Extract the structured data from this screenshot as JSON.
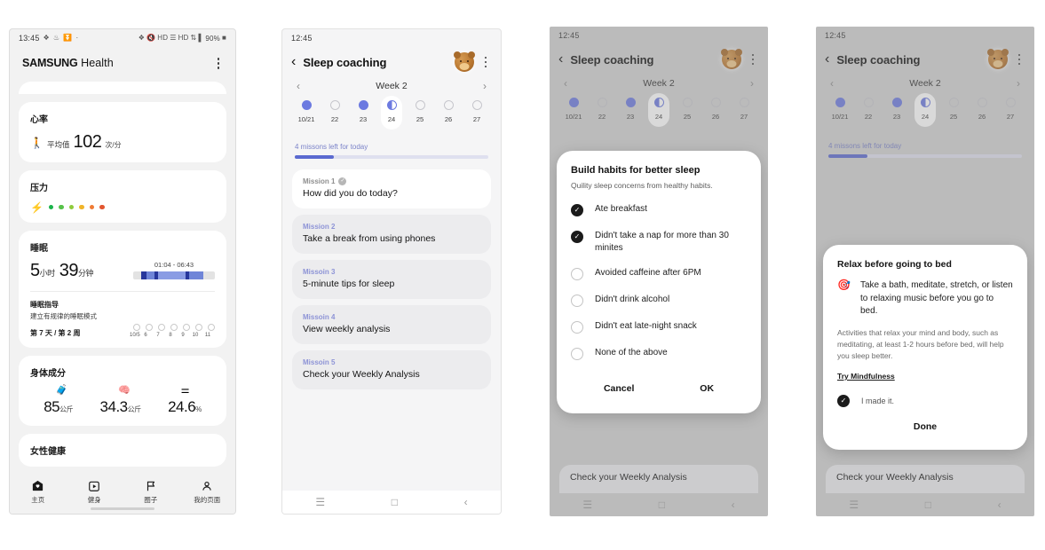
{
  "phone1": {
    "status": {
      "time": "13:45",
      "left_icons": [
        "location-icon",
        "nfc-icon",
        "vpn-icon",
        "dot-icon"
      ],
      "right_icons": [
        "bluetooth-icon",
        "mute-icon",
        "hd-icon",
        "signal-icon",
        "hd2-icon",
        "data-icon",
        "signal2-icon"
      ],
      "battery": "90%"
    },
    "app_title_bold": "SAMSUNG",
    "app_title_light": " Health",
    "menu_icon": "kebab-menu-icon",
    "cards": {
      "heart_rate": {
        "title": "心率",
        "icon": "walking-person-icon",
        "label": "平均值",
        "value": "102",
        "unit": "次/分"
      },
      "stress": {
        "title": "压力",
        "bolt_icon": "lightning-bolt-icon",
        "dot_colors": [
          "#19b34a",
          "#57c24a",
          "#8fcb3c",
          "#f0b429",
          "#ef7b34",
          "#e2562f"
        ]
      },
      "sleep": {
        "title": "睡眠",
        "hours": "5",
        "hours_unit": "小时",
        "minutes": "39",
        "minutes_unit": "分钟",
        "range": "01:04 - 06:43",
        "coach_title": "睡眠指导",
        "coach_sub": "建立有规律的睡眠模式",
        "coach_day": "第 7 天 / 第 2 周",
        "day_labels": [
          "10/5",
          "6",
          "7",
          "8",
          "9",
          "10",
          "11"
        ]
      },
      "body": {
        "title": "身体成分",
        "icons": [
          "scale-icon",
          "muscle-icon",
          "fat-icon"
        ],
        "values": [
          "85",
          "34.3",
          "24.6"
        ],
        "units": [
          "公斤",
          "公斤",
          "%"
        ]
      },
      "women": {
        "title": "女性健康"
      }
    },
    "tabs": [
      {
        "label": "主页",
        "icon": "home-heart-icon"
      },
      {
        "label": "健身",
        "icon": "fitness-video-icon"
      },
      {
        "label": "圈子",
        "icon": "flag-icon"
      },
      {
        "label": "我的页面",
        "icon": "person-icon"
      }
    ]
  },
  "sleep_coaching": {
    "status_time": "12:45",
    "back_icon": "chevron-left-icon",
    "title": "Sleep coaching",
    "avatar": "bear-avatar-icon",
    "menu_icon": "kebab-menu-icon",
    "week_label": "Week 2",
    "prev_icon": "chevron-left-icon",
    "next_icon": "chevron-right-icon",
    "days": [
      {
        "label": "10/21",
        "state": "filled"
      },
      {
        "label": "22",
        "state": "empty"
      },
      {
        "label": "23",
        "state": "filled"
      },
      {
        "label": "24",
        "state": "half"
      },
      {
        "label": "25",
        "state": "empty"
      },
      {
        "label": "26",
        "state": "empty"
      },
      {
        "label": "27",
        "state": "empty"
      }
    ],
    "progress_label": "4 missons left for today",
    "progress_percent": 20,
    "missions": [
      {
        "num": "Mission 1",
        "title": "How did you do today?",
        "done_icon": "check-circle-icon",
        "style": "white"
      },
      {
        "num": "Mission 2",
        "title": "Take a break from using phones",
        "style": "grey"
      },
      {
        "num": "Missoin 3",
        "title": "5-minute tips for sleep",
        "style": "grey"
      },
      {
        "num": "Missoin 4",
        "title": "View weekly analysis",
        "style": "grey"
      },
      {
        "num": "Missoin 5",
        "title": "Check your Weekly Analysis",
        "style": "grey"
      }
    ],
    "nav_icons": [
      "recents-icon",
      "home-icon",
      "back-icon"
    ]
  },
  "dialog_habits": {
    "title": "Build habits for better sleep",
    "subtitle": "Quility sleep concerns from healthy habits.",
    "options": [
      {
        "label": "Ate breakfast",
        "checked": true
      },
      {
        "label": "Didn't take a nap for more than 30 minites",
        "checked": true
      },
      {
        "label": "Avoided caffeine after 6PM",
        "checked": false
      },
      {
        "label": "Didn't drink alcohol",
        "checked": false
      },
      {
        "label": "Didn't eat late-night snack",
        "checked": false
      },
      {
        "label": "None of the above",
        "checked": false
      }
    ],
    "cancel_label": "Cancel",
    "ok_label": "OK",
    "footer_text": "Check your Weekly Analysis"
  },
  "dialog_relax": {
    "title": "Relax before going to bed",
    "icon": "target-dart-icon",
    "main_text": "Take a bath, meditate, stretch, or listen to relaxing music before you go to bed.",
    "body_text": "Activities that relax your mind and body, such as meditating, at least 1-2 hours before bed, will help you sleep better.",
    "link_label": "Try Mindfulness",
    "made_it_label": "I made it.",
    "done_label": "Done",
    "footer_text": "Check your Weekly Analysis"
  },
  "colors": {
    "accent_purple": "#6c7ae0",
    "progress_fill": "#5b6ad0",
    "tap_ring": "#b7b4e8",
    "sleep_bar": "#6f85d8"
  }
}
